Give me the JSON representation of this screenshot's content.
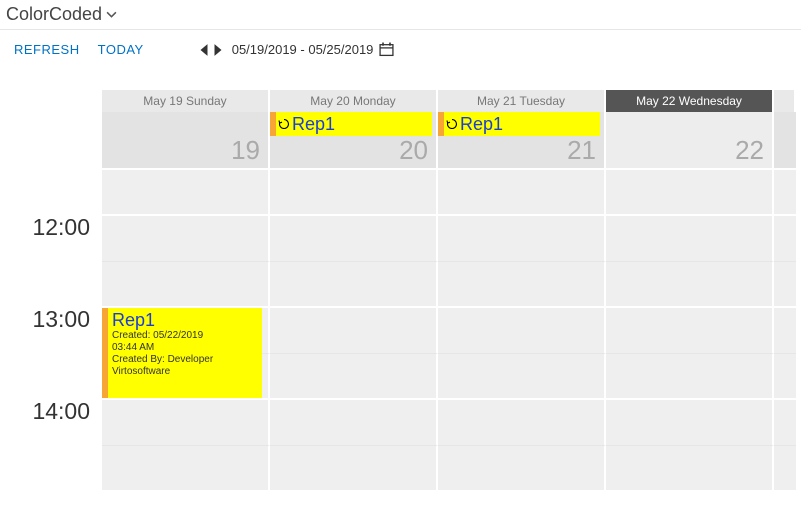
{
  "page_title": "ColorCoded",
  "toolbar": {
    "refresh": "REFRESH",
    "today": "TODAY",
    "date_range": "05/19/2019 - 05/25/2019"
  },
  "days": [
    {
      "header": "May 19 Sunday",
      "num": "19",
      "today": false
    },
    {
      "header": "May 20 Monday",
      "num": "20",
      "today": false
    },
    {
      "header": "May 21 Tuesday",
      "num": "21",
      "today": false
    },
    {
      "header": "May 22 Wednesday",
      "num": "22",
      "today": true
    }
  ],
  "times": [
    "12:00",
    "13:00",
    "14:00"
  ],
  "allday_events": {
    "1": {
      "title": "Rep1"
    },
    "2": {
      "title": "Rep1"
    }
  },
  "timed_event": {
    "title": "Rep1",
    "line1": "Created: 05/22/2019",
    "line2": "03:44 AM",
    "line3": "Created By: Developer",
    "line4": "Virtosoftware"
  }
}
